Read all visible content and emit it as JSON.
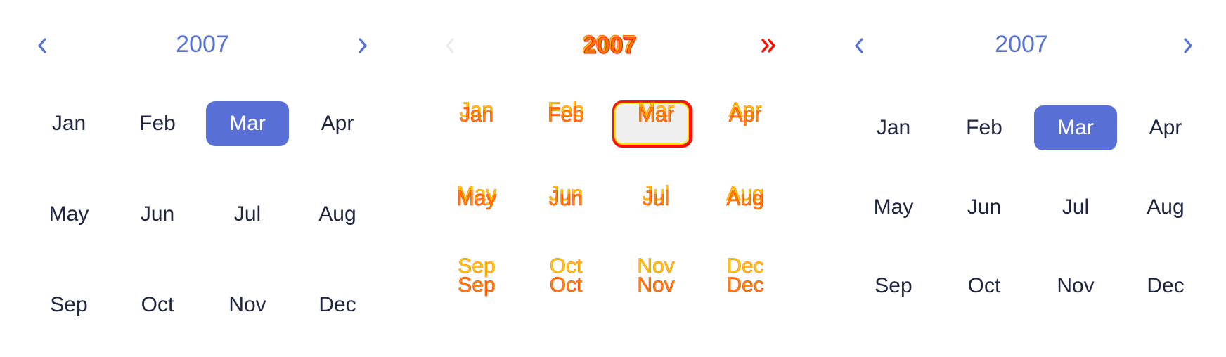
{
  "left": {
    "year": "2007",
    "months": [
      "Jan",
      "Feb",
      "Mar",
      "Apr",
      "May",
      "Jun",
      "Jul",
      "Aug",
      "Sep",
      "Oct",
      "Nov",
      "Dec"
    ],
    "selected": "Mar"
  },
  "middle": {
    "year": "2007",
    "months": [
      "Jan",
      "Feb",
      "Mar",
      "Apr",
      "May",
      "Jun",
      "Jul",
      "Aug",
      "Sep",
      "Oct",
      "Nov",
      "Dec"
    ],
    "selected": "Mar",
    "next_label": "»"
  },
  "right": {
    "year": "2007",
    "months": [
      "Jan",
      "Feb",
      "Mar",
      "Apr",
      "May",
      "Jun",
      "Jul",
      "Aug",
      "Sep",
      "Oct",
      "Nov",
      "Dec"
    ],
    "selected": "Mar"
  },
  "colors": {
    "accent": "#5873d6",
    "text": "#1d2540",
    "diff_red": "#ff1000",
    "diff_orange": "#ff8a00",
    "diff_yellow": "#ffd400"
  },
  "icons": {
    "prev": "chevron-left-icon",
    "next": "chevron-right-icon",
    "double_next": "double-chevron-right-icon"
  }
}
